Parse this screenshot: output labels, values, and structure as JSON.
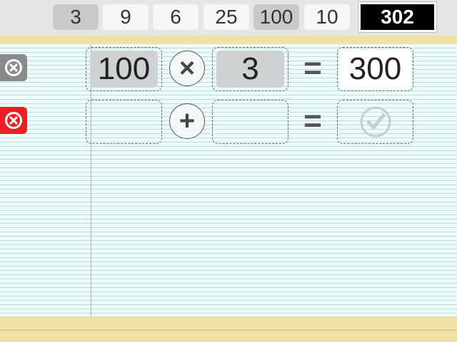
{
  "tiles": [
    {
      "value": "3",
      "used": true
    },
    {
      "value": "9",
      "used": false
    },
    {
      "value": "6",
      "used": false
    },
    {
      "value": "25",
      "used": false
    },
    {
      "value": "100",
      "used": true
    },
    {
      "value": "10",
      "used": false
    }
  ],
  "target": "302",
  "rows": [
    {
      "left": "100",
      "operator": "×",
      "right": "3",
      "equals": "=",
      "result": "300"
    },
    {
      "left": "",
      "operator": "+",
      "right": "",
      "equals": "=",
      "result": ""
    }
  ],
  "colors": {
    "delete_inactive": "#8a8a8a",
    "delete_active": "#ee1c24",
    "paper": "#effcfc",
    "strip": "#efe0a6"
  },
  "icons": {
    "delete": "close-circle-icon",
    "check": "check-circle-icon"
  }
}
